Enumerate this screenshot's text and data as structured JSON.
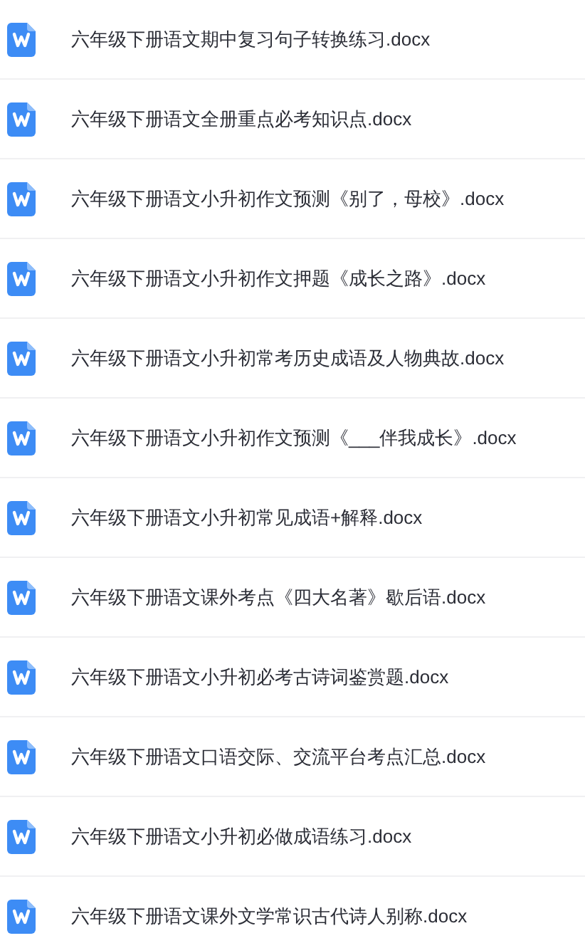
{
  "files": [
    {
      "name": "六年级下册语文期中复习句子转换练习.docx"
    },
    {
      "name": "六年级下册语文全册重点必考知识点.docx"
    },
    {
      "name": "六年级下册语文小升初作文预测《别了，母校》.docx"
    },
    {
      "name": "六年级下册语文小升初作文押题《成长之路》.docx"
    },
    {
      "name": "六年级下册语文小升初常考历史成语及人物典故.docx"
    },
    {
      "name": "六年级下册语文小升初作文预测《___伴我成长》.docx"
    },
    {
      "name": "六年级下册语文小升初常见成语+解释.docx"
    },
    {
      "name": "六年级下册语文课外考点《四大名著》歇后语.docx"
    },
    {
      "name": "六年级下册语文小升初必考古诗词鉴赏题.docx"
    },
    {
      "name": "六年级下册语文口语交际、交流平台考点汇总.docx"
    },
    {
      "name": "六年级下册语文小升初必做成语练习.docx"
    },
    {
      "name": "六年级下册语文课外文学常识古代诗人别称.docx"
    }
  ]
}
